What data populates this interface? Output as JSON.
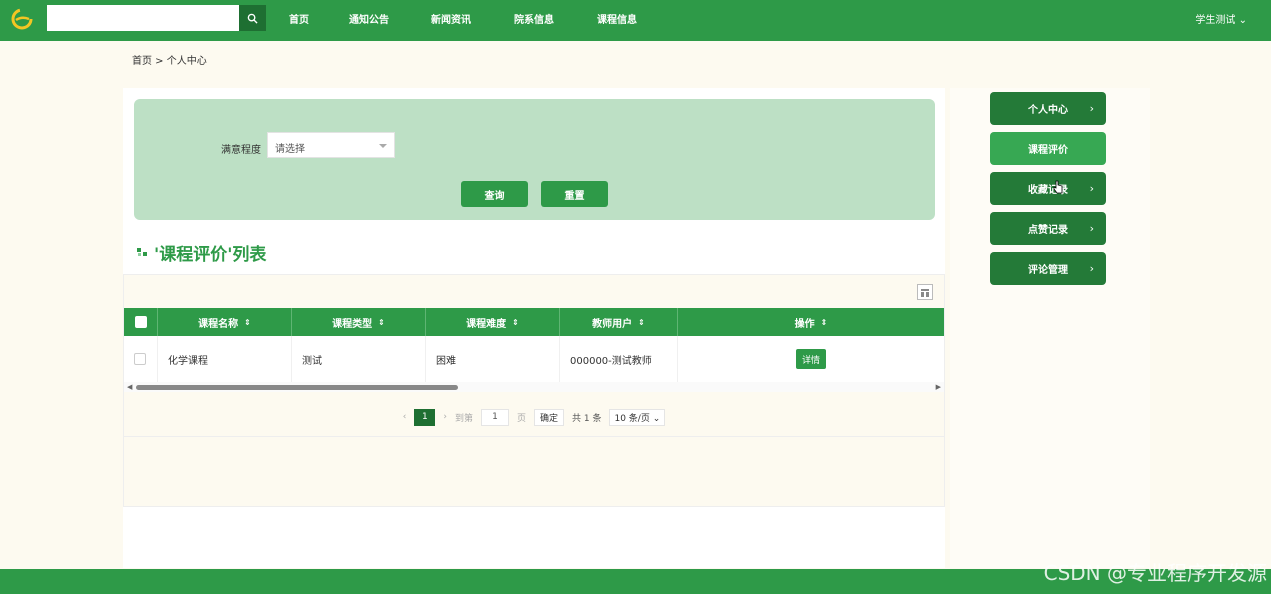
{
  "nav": {
    "search_placeholder": "",
    "items": [
      "首页",
      "通知公告",
      "新闻资讯",
      "院系信息",
      "课程信息"
    ],
    "user_label": "学生测试",
    "user_caret": "⌄"
  },
  "breadcrumb": "首页 > 个人中心",
  "filter": {
    "label": "满意程度",
    "select_value": "请选择",
    "search_label": "查询",
    "reset_label": "重置"
  },
  "list": {
    "title": "'课程评价'列表",
    "columns": [
      "课程名称",
      "课程类型",
      "课程难度",
      "教师用户",
      "操作"
    ],
    "sort_glyph": "⇕",
    "rows": [
      {
        "name": "化学课程",
        "type": "测试",
        "difficulty": "困难",
        "teacher": "000000-测试教师",
        "action": "详情"
      }
    ]
  },
  "pager": {
    "prev": "‹",
    "current": "1",
    "next": "›",
    "goto_label": "到第",
    "goto_value": "1",
    "page_unit": "页",
    "confirm": "确定",
    "total": "共 1 条",
    "page_size": "10 条/页 ⌄"
  },
  "sidebar": {
    "items": [
      {
        "label": "个人中心",
        "chevron": "›"
      },
      {
        "label": "课程评价",
        "chevron": ""
      },
      {
        "label": "收藏记录",
        "chevron": "›"
      },
      {
        "label": "点赞记录",
        "chevron": "›"
      },
      {
        "label": "评论管理",
        "chevron": "›"
      }
    ]
  },
  "watermark": "CSDN @专业程序开发源",
  "colors": {
    "primary": "#2e9a48",
    "dark": "#1e6f32",
    "filter_bg": "#bde0c5"
  }
}
